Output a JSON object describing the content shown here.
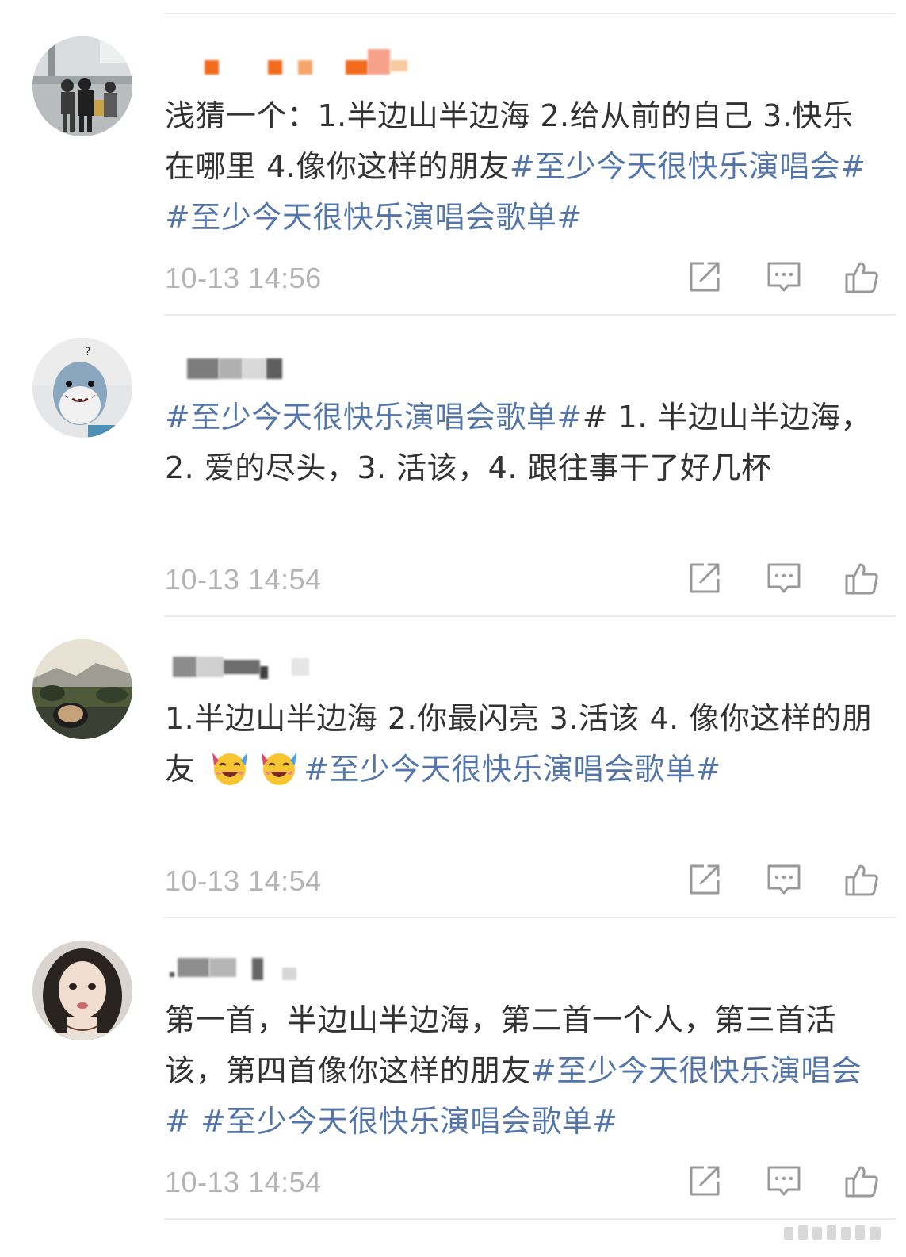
{
  "comments": [
    {
      "text_segments": [
        {
          "type": "text",
          "value": "浅猜一个：1.半边山半边海 2.给从前的自己 3.快乐在哪里 4.像你这样的朋友"
        },
        {
          "type": "tag",
          "value": "#至少今天很快乐演唱会#"
        },
        {
          "type": "text",
          "value": " "
        },
        {
          "type": "tag",
          "value": "#至少今天很快乐演唱会歌单#"
        }
      ],
      "time": "10-13 14:56",
      "avatar": "avatar-photo-airport"
    },
    {
      "text_segments": [
        {
          "type": "tag",
          "value": "#至少今天很快乐演唱会歌单#"
        },
        {
          "type": "text",
          "value": "#  1. 半边山半边海，2. 爱的尽头，3. 活该，4. 跟往事干了好几杯"
        }
      ],
      "time": "10-13 14:54",
      "avatar": "avatar-shark"
    },
    {
      "text_segments": [
        {
          "type": "text",
          "value": "1.半边山半边海   2.你最闪亮  3.活该 4. 像你这样的朋友  "
        },
        {
          "type": "emoji",
          "value": "cheering-emoji"
        },
        {
          "type": "emoji",
          "value": "cheering-emoji"
        },
        {
          "type": "tag",
          "value": "#至少今天很快乐演唱会歌单#"
        }
      ],
      "time": "10-13 14:54",
      "avatar": "avatar-landscape"
    },
    {
      "text_segments": [
        {
          "type": "text",
          "value": "第一首，半边山半边海，第二首一个人，第三首活该，第四首像你这样的朋友"
        },
        {
          "type": "tag",
          "value": "#至少今天很快乐演唱会#"
        },
        {
          "type": "text",
          "value": " "
        },
        {
          "type": "tag",
          "value": "#至少今天很快乐演唱会歌单#"
        }
      ],
      "time": "10-13 14:54",
      "avatar": "avatar-girl"
    }
  ],
  "icons": {
    "share": "share-icon",
    "reply": "comment-icon",
    "like": "thumbs-up-icon"
  },
  "colors": {
    "hashtag": "#5475a8",
    "text": "#333333",
    "timestamp": "#b4b4b4",
    "icon": "#9a9a9a",
    "divider": "#ededed"
  }
}
